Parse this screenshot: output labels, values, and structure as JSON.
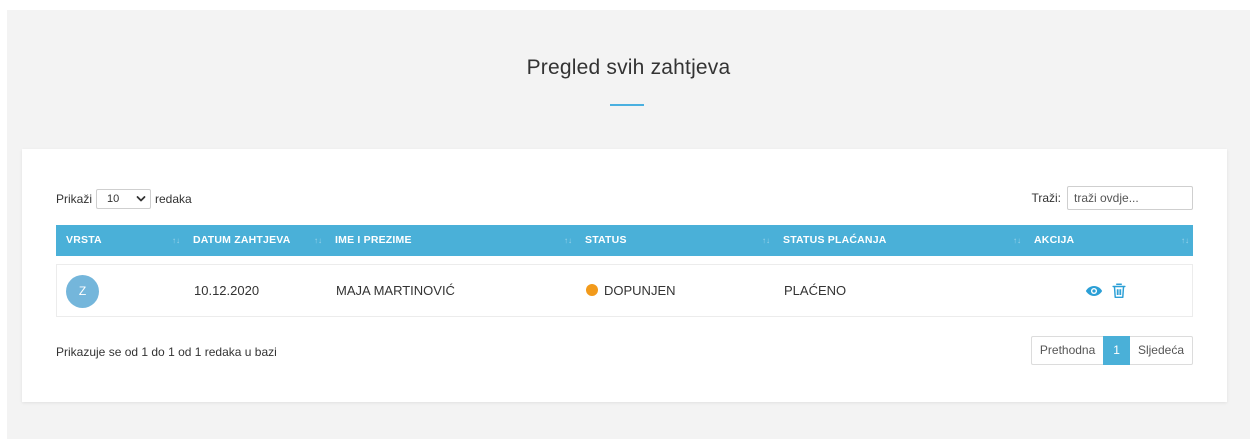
{
  "header": {
    "title": "Pregled svih zahtjeva"
  },
  "colors": {
    "accent": "#4ab0d8",
    "status_dopunjen": "#f29a1b",
    "avatar": "#74b6db"
  },
  "length": {
    "prefix": "Prikaži",
    "value": "10",
    "suffix": "redaka"
  },
  "search": {
    "label": "Traži:",
    "placeholder": "traži ovdje..."
  },
  "table": {
    "columns": [
      "VRSTA",
      "DATUM ZAHTJEVA",
      "IME I PREZIME",
      "STATUS",
      "STATUS PLAĆANJA",
      "AKCIJA"
    ],
    "sort_icon": "↑↓",
    "rows": [
      {
        "vrsta": "Z",
        "datum": "10.12.2020",
        "ime": "MAJA MARTINOVIĆ",
        "status": "DOPUNJEN",
        "status_placanja": "PLAĆENO",
        "actions": [
          "eye-icon",
          "trash-icon"
        ]
      }
    ]
  },
  "footer": {
    "info": "Prikazuje se od 1 do 1 od 1 redaka u bazi",
    "pagination": {
      "prev": "Prethodna",
      "current": "1",
      "next": "Sljedeća"
    }
  }
}
